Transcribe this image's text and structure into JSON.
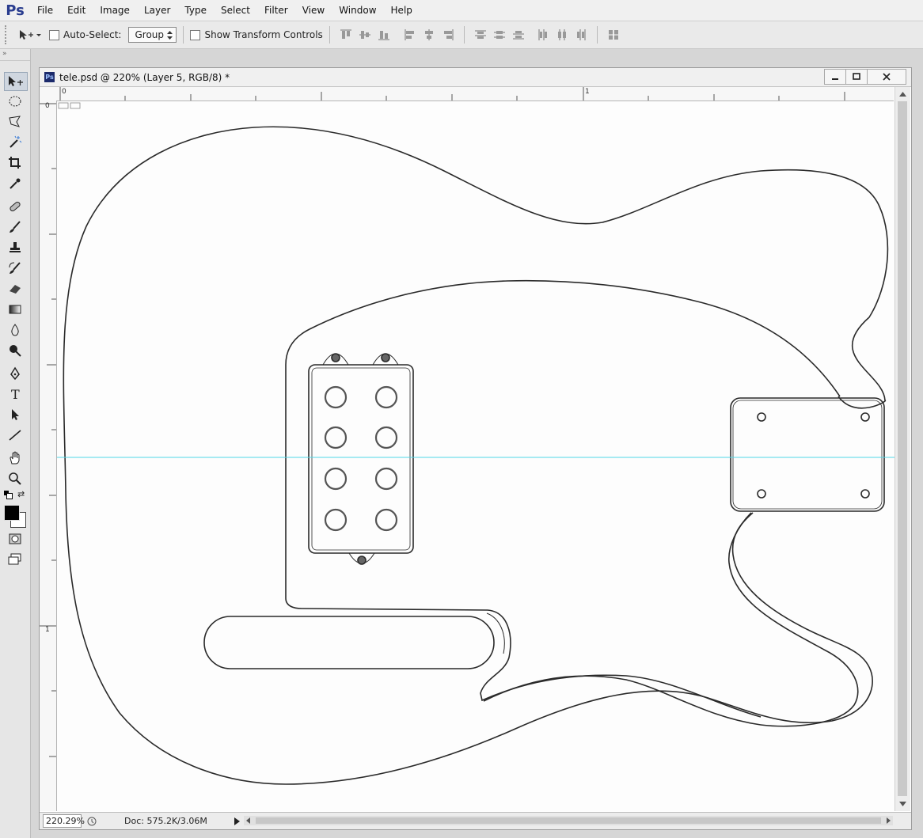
{
  "app": {
    "logo": "Ps"
  },
  "menu": [
    "File",
    "Edit",
    "Image",
    "Layer",
    "Type",
    "Select",
    "Filter",
    "View",
    "Window",
    "Help"
  ],
  "options": {
    "auto_select_label": "Auto-Select:",
    "auto_select_checked": false,
    "group_value": "Group",
    "show_transform_label": "Show Transform Controls",
    "show_transform_checked": false
  },
  "document": {
    "title": "tele.psd @ 220% (Layer 5, RGB/8) *",
    "ruler_top_labels": [
      "0",
      "1"
    ],
    "ruler_left_labels": [
      "0",
      "1"
    ],
    "zoom": "220.29%",
    "doc_info": "Doc: 575.2K/3.06M"
  },
  "tools": [
    "move-tool",
    "marquee-tool",
    "lasso-tool",
    "quick-select-tool",
    "crop-tool",
    "eyedropper-tool",
    "healing-brush-tool",
    "brush-tool",
    "clone-stamp-tool",
    "history-brush-tool",
    "eraser-tool",
    "gradient-tool",
    "blur-tool",
    "dodge-tool",
    "pen-tool",
    "type-tool",
    "path-selection-tool",
    "line-tool",
    "hand-tool",
    "zoom-tool"
  ],
  "colors": {
    "foreground": "#000000",
    "background": "#ffffff",
    "guide": "#4fd6e6"
  }
}
